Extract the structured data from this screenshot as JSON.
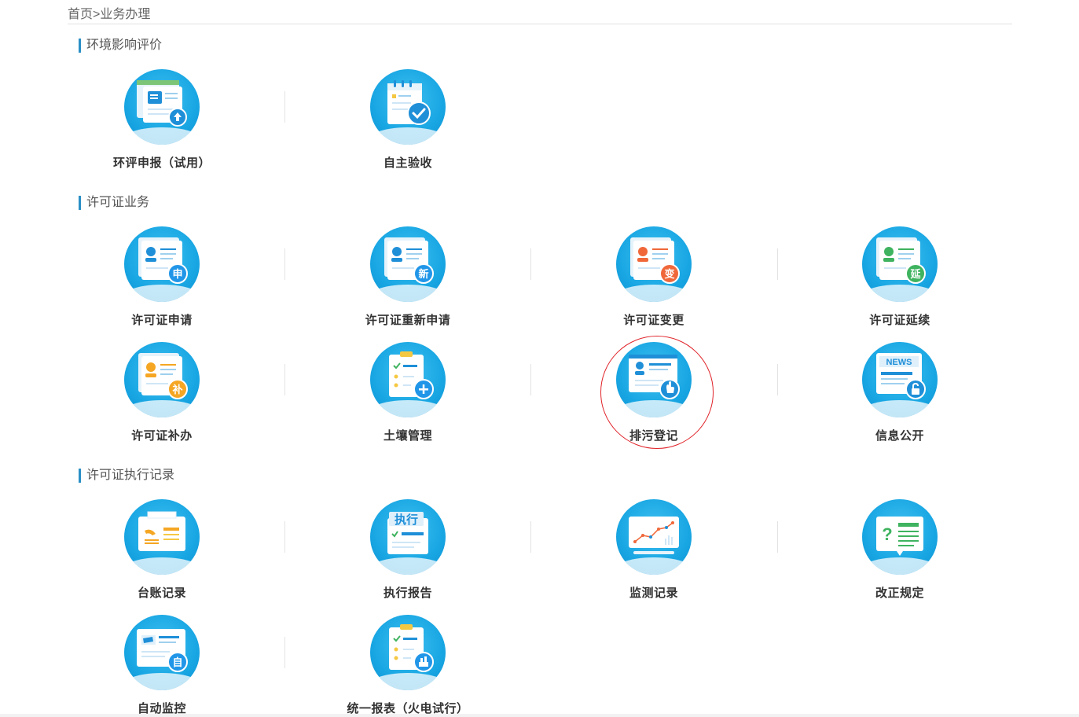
{
  "breadcrumb": "首页>业务办理",
  "sections": {
    "eia": {
      "title": "环境影响评价",
      "items": [
        {
          "label": "环评申报（试用）"
        },
        {
          "label": "自主验收"
        }
      ]
    },
    "permit": {
      "title": "许可证业务",
      "items": [
        {
          "label": "许可证申请",
          "badge": "申",
          "badge_color": "#2196e8"
        },
        {
          "label": "许可证重新申请",
          "badge": "新",
          "badge_color": "#2196e8"
        },
        {
          "label": "许可证变更",
          "badge": "变",
          "badge_color": "#f0683a"
        },
        {
          "label": "许可证延续",
          "badge": "延",
          "badge_color": "#3fb35f"
        },
        {
          "label": "许可证补办",
          "badge": "补",
          "badge_color": "#f5a623"
        },
        {
          "label": "土壤管理"
        },
        {
          "label": "排污登记"
        },
        {
          "label": "信息公开",
          "news": "NEWS"
        }
      ]
    },
    "record": {
      "title": "许可证执行记录",
      "items": [
        {
          "label": "台账记录"
        },
        {
          "label": "执行报告",
          "tag": "执行"
        },
        {
          "label": "监测记录"
        },
        {
          "label": "改正规定",
          "mark": "?"
        },
        {
          "label": "自动监控",
          "badge": "自",
          "badge_color": "#2196e8"
        },
        {
          "label": "统一报表（火电试行）"
        }
      ]
    }
  }
}
